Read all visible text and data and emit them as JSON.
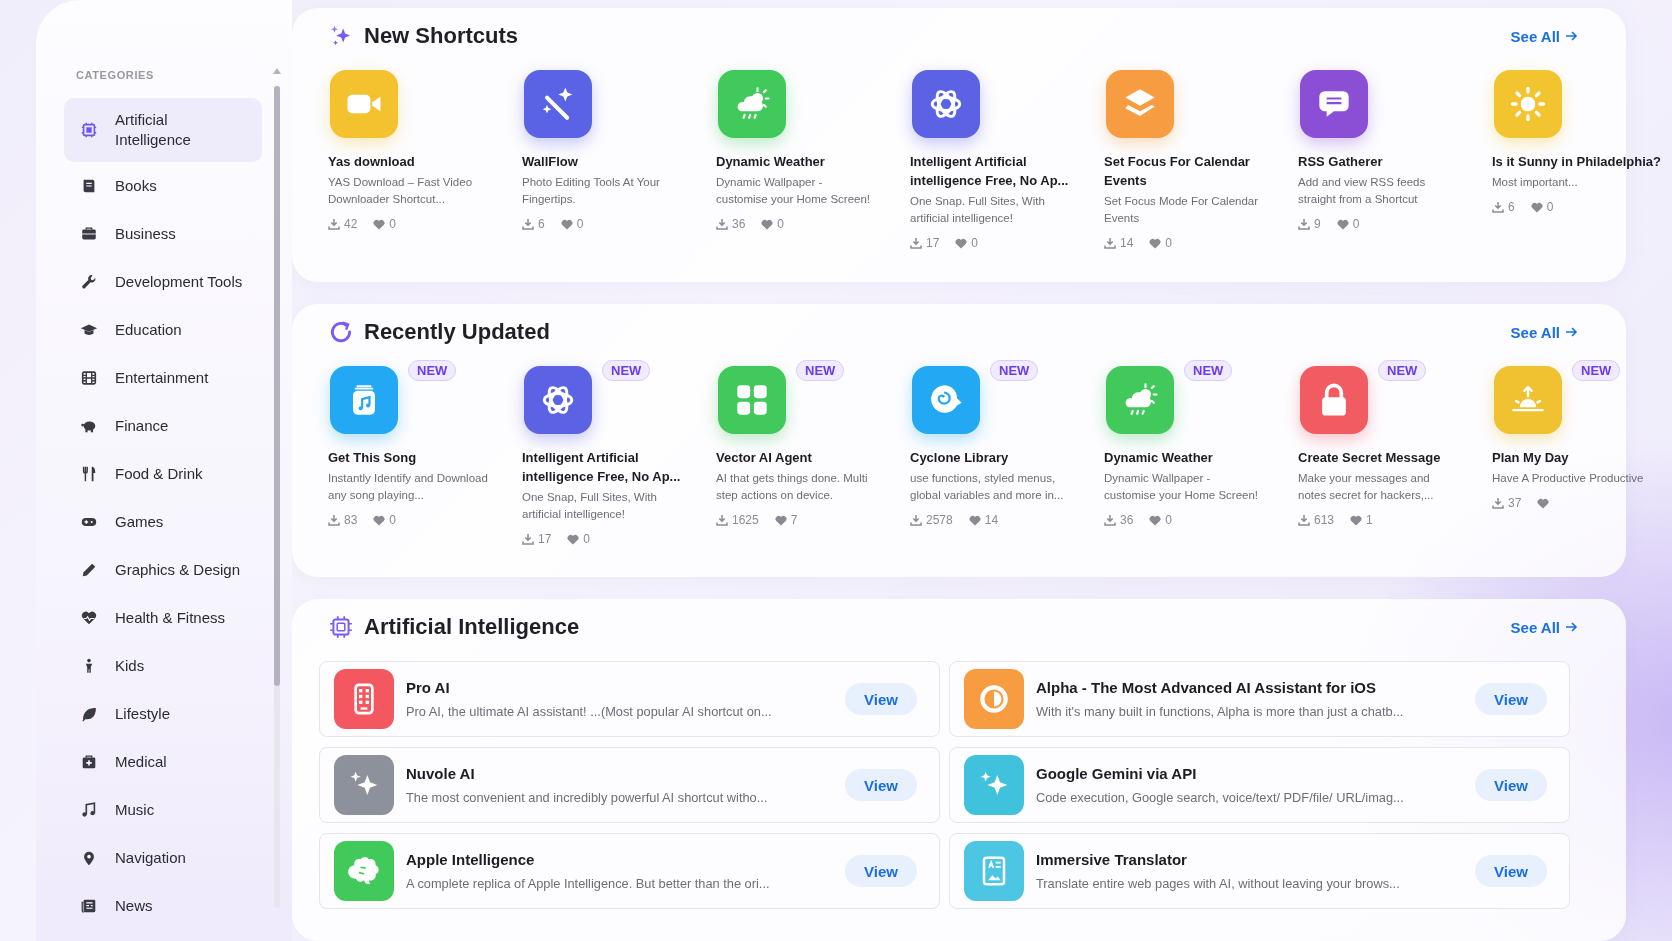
{
  "sidebar": {
    "heading": "CATEGORIES",
    "items": [
      {
        "label": "Artificial Intelligence",
        "selected": true
      },
      {
        "label": "Books",
        "selected": false
      },
      {
        "label": "Business",
        "selected": false
      },
      {
        "label": "Development Tools",
        "selected": false
      },
      {
        "label": "Education",
        "selected": false
      },
      {
        "label": "Entertainment",
        "selected": false
      },
      {
        "label": "Finance",
        "selected": false
      },
      {
        "label": "Food & Drink",
        "selected": false
      },
      {
        "label": "Games",
        "selected": false
      },
      {
        "label": "Graphics & Design",
        "selected": false
      },
      {
        "label": "Health & Fitness",
        "selected": false
      },
      {
        "label": "Kids",
        "selected": false
      },
      {
        "label": "Lifestyle",
        "selected": false
      },
      {
        "label": "Medical",
        "selected": false
      },
      {
        "label": "Music",
        "selected": false
      },
      {
        "label": "Navigation",
        "selected": false
      },
      {
        "label": "News",
        "selected": false
      }
    ]
  },
  "sections": [
    {
      "kind": "cards",
      "title": "New Shortcuts",
      "link": "See All",
      "cards": [
        {
          "title": "Yas download",
          "description": "YAS Download – Fast Video Downloader Shortcut...",
          "downloads": "42",
          "likes": "0",
          "color": "#f4c22f"
        },
        {
          "title": "WallFlow",
          "description": "Photo Editing Tools At Your Fingertips.",
          "downloads": "6",
          "likes": "0",
          "color": "#5a63e6"
        },
        {
          "title": "Dynamic Weather",
          "description": "Dynamic Wallpaper - customise your Home Screen!",
          "downloads": "36",
          "likes": "0",
          "color": "#42c95c"
        },
        {
          "title": "Intelligent Artificial intelligence Free, No Ap...",
          "description": "One Snap. Full Sites, With artificial intelligence!",
          "downloads": "17",
          "likes": "0",
          "color": "#5b62e4"
        },
        {
          "title": "Set Focus For Calendar Events",
          "description": "Set Focus Mode For Calendar Events",
          "downloads": "14",
          "likes": "0",
          "color": "#f89c42"
        },
        {
          "title": "RSS Gatherer",
          "description": "Add and view RSS feeds straight from a Shortcut",
          "downloads": "9",
          "likes": "0",
          "color": "#8b4fd6"
        },
        {
          "title": "Is it Sunny in Philadelphia?",
          "description": "Most important...",
          "downloads": "6",
          "likes": "0",
          "color": "#f2c530"
        }
      ]
    },
    {
      "kind": "cards",
      "title": "Recently Updated",
      "link": "See All",
      "cards": [
        {
          "title": "Get This Song",
          "description": "Instantly Identify and Download any song playing...",
          "downloads": "83",
          "likes": "0",
          "color": "#23a8f4",
          "badge": "NEW"
        },
        {
          "title": "Intelligent Artificial intelligence Free, No Ap...",
          "description": "One Snap, Full Sites, With artificial intelligence!",
          "downloads": "17",
          "likes": "0",
          "color": "#5b62e4",
          "badge": "NEW"
        },
        {
          "title": "Vector AI Agent",
          "description": "AI that gets things done. Multi step actions on device.",
          "downloads": "1625",
          "likes": "7",
          "color": "#42c95c",
          "badge": "NEW"
        },
        {
          "title": "Cyclone Library",
          "description": "use functions, styled menus, global variables and more in...",
          "downloads": "2578",
          "likes": "14",
          "color": "#23a8f4",
          "badge": "NEW"
        },
        {
          "title": "Dynamic Weather",
          "description": "Dynamic Wallpaper - customise your Home Screen!",
          "downloads": "36",
          "likes": "0",
          "color": "#42c95c",
          "badge": "NEW"
        },
        {
          "title": "Create Secret Message",
          "description": "Make your messages and notes secret for hackers,...",
          "downloads": "613",
          "likes": "1",
          "color": "#f35b63",
          "badge": "NEW"
        },
        {
          "title": "Plan My Day",
          "description": "Have A Productive Productive",
          "downloads": "37",
          "color": "#f0c232",
          "badge": "NEW"
        }
      ]
    },
    {
      "kind": "list",
      "title": "Artificial Intelligence",
      "link": "See All",
      "items": [
        {
          "title": "Pro AI",
          "description": "Pro AI, the ultimate AI assistant! ...(Most popular AI shortcut on...",
          "button": "View",
          "color": "#f3575f"
        },
        {
          "title": "Alpha - The Most Advanced AI Assistant for iOS",
          "description": "With it's many built in functions, Alpha is more than just a chatb...",
          "button": "View",
          "color": "#f89c42"
        },
        {
          "title": "Nuvole AI",
          "description": "The most convenient and incredibly powerful AI shortcut witho...",
          "button": "View",
          "color": "#8d919b"
        },
        {
          "title": "Google Gemini via API",
          "description": "Code execution, Google search, voice/text/ PDF/file/ URL/imag...",
          "button": "View",
          "color": "#40c2dc"
        },
        {
          "title": "Apple Intelligence",
          "description": "A complete replica of Apple Intelligence. But better than the ori...",
          "button": "View",
          "color": "#42c95c"
        },
        {
          "title": "Immersive Translator",
          "description": "Translate entire web pages with AI, without leaving your brows...",
          "button": "View",
          "color": "#4cc6e2"
        }
      ]
    }
  ]
}
